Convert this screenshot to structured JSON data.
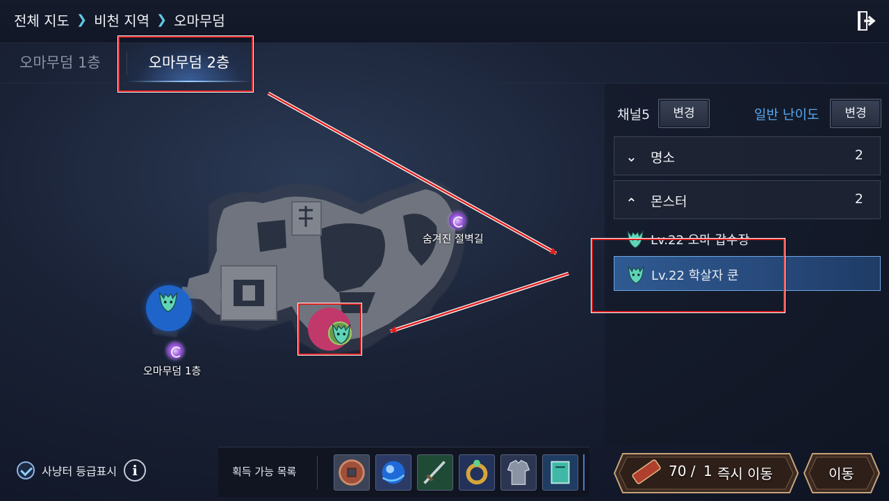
{
  "breadcrumb": {
    "items": [
      "전체 지도",
      "비천 지역",
      "오마무덤"
    ],
    "separator": ">"
  },
  "tabs": [
    {
      "label": "오마무덤 1층",
      "active": false
    },
    {
      "label": "오마무덤 2층",
      "active": true
    }
  ],
  "map": {
    "labels": {
      "hidden_path": "숨겨진 절벽길",
      "floor1_portal": "오마무덤 1층"
    }
  },
  "side_panel": {
    "channel_label": "채널5",
    "channel_button": "변경",
    "difficulty_label": "일반 난이도",
    "difficulty_button": "변경",
    "sections": [
      {
        "title": "명소",
        "count": "2",
        "expanded": false
      },
      {
        "title": "몬스터",
        "count": "2",
        "expanded": true
      }
    ],
    "monsters": [
      {
        "label": "Lv.22 오마 갑수장",
        "selected": false
      },
      {
        "label": "Lv.22 학살자 쿤",
        "selected": true
      }
    ]
  },
  "bottom": {
    "grade_toggle_label": "사냥터 등급표시",
    "grade_toggle_checked": true,
    "info_glyph": "i",
    "loot_title": "획득 가능 목록",
    "loot_items": [
      "coin-icon",
      "blue-orb-icon",
      "sword-icon",
      "gold-ring-icon",
      "armor-icon",
      "book-icon"
    ],
    "teleport_count": "70 /",
    "teleport_max": "1",
    "teleport_label": "즉시 이동",
    "move_label": "이동"
  },
  "colors": {
    "accent_blue": "#59a6ee",
    "highlight_red": "#e02020",
    "zone_blue": "#1f64c9",
    "zone_red": "#c1386a"
  }
}
